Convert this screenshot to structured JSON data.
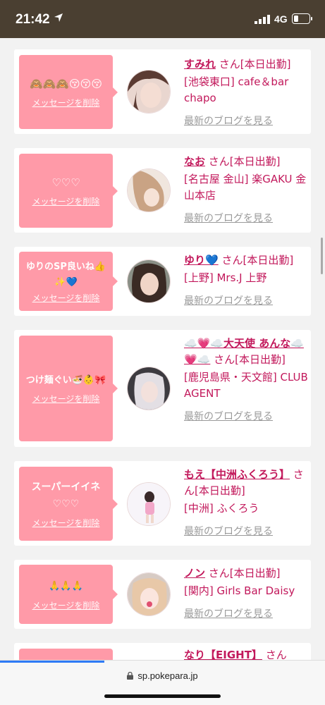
{
  "status_bar": {
    "time": "21:42",
    "network": "4G"
  },
  "cards": [
    {
      "message": "🙈🙈🙈😚😚😚",
      "delete_label": "メッセージを削除",
      "name": "すみれ",
      "san": "さん[本日出勤]",
      "shop": "[池袋東口] cafe＆bar chapo",
      "blog_label": "最新のブログを見る"
    },
    {
      "message": "♡♡♡",
      "delete_label": "メッセージを削除",
      "name": "なお",
      "san": "さん[本日出勤]",
      "shop": "[名古屋 金山] 楽GAKU 金山本店",
      "blog_label": "最新のブログを見る"
    },
    {
      "message": "ゆりのSP良いね👍✨💙",
      "delete_label": "メッセージを削除",
      "name": "ゆり💙",
      "san": "さん[本日出勤]",
      "shop": "[上野] Mrs.J 上野",
      "blog_label": "最新のブログを見る"
    },
    {
      "message": "つけ麺ぐい🍜👶🎀",
      "delete_label": "メッセージを削除",
      "name": "☁️💗☁️大天使 あんな☁️💗☁️",
      "san": "さん[本日出勤]",
      "shop": "[鹿児島県・天文館] CLUB AGENT",
      "blog_label": "最新のブログを見る"
    },
    {
      "message": "スーパーイイネ♡♡♡",
      "delete_label": "メッセージを削除",
      "name": "もえ【中洲ふくろう】",
      "san": "さん[本日出勤]",
      "shop": "[中洲] ふくろう",
      "blog_label": "最新のブログを見る"
    },
    {
      "message": "🙏🙏🙏",
      "delete_label": "メッセージを削除",
      "name": "ノン",
      "san": "さん[本日出勤]",
      "shop": "[関内] Girls Bar Daisy",
      "blog_label": "最新のブログを見る"
    },
    {
      "message": "",
      "delete_label": "",
      "name": "なり【EIGHT】",
      "san": "さん",
      "shop": "",
      "blog_label": ""
    }
  ],
  "bottom_bar": {
    "url": "sp.pokepara.jp",
    "load_progress": 0.32
  }
}
